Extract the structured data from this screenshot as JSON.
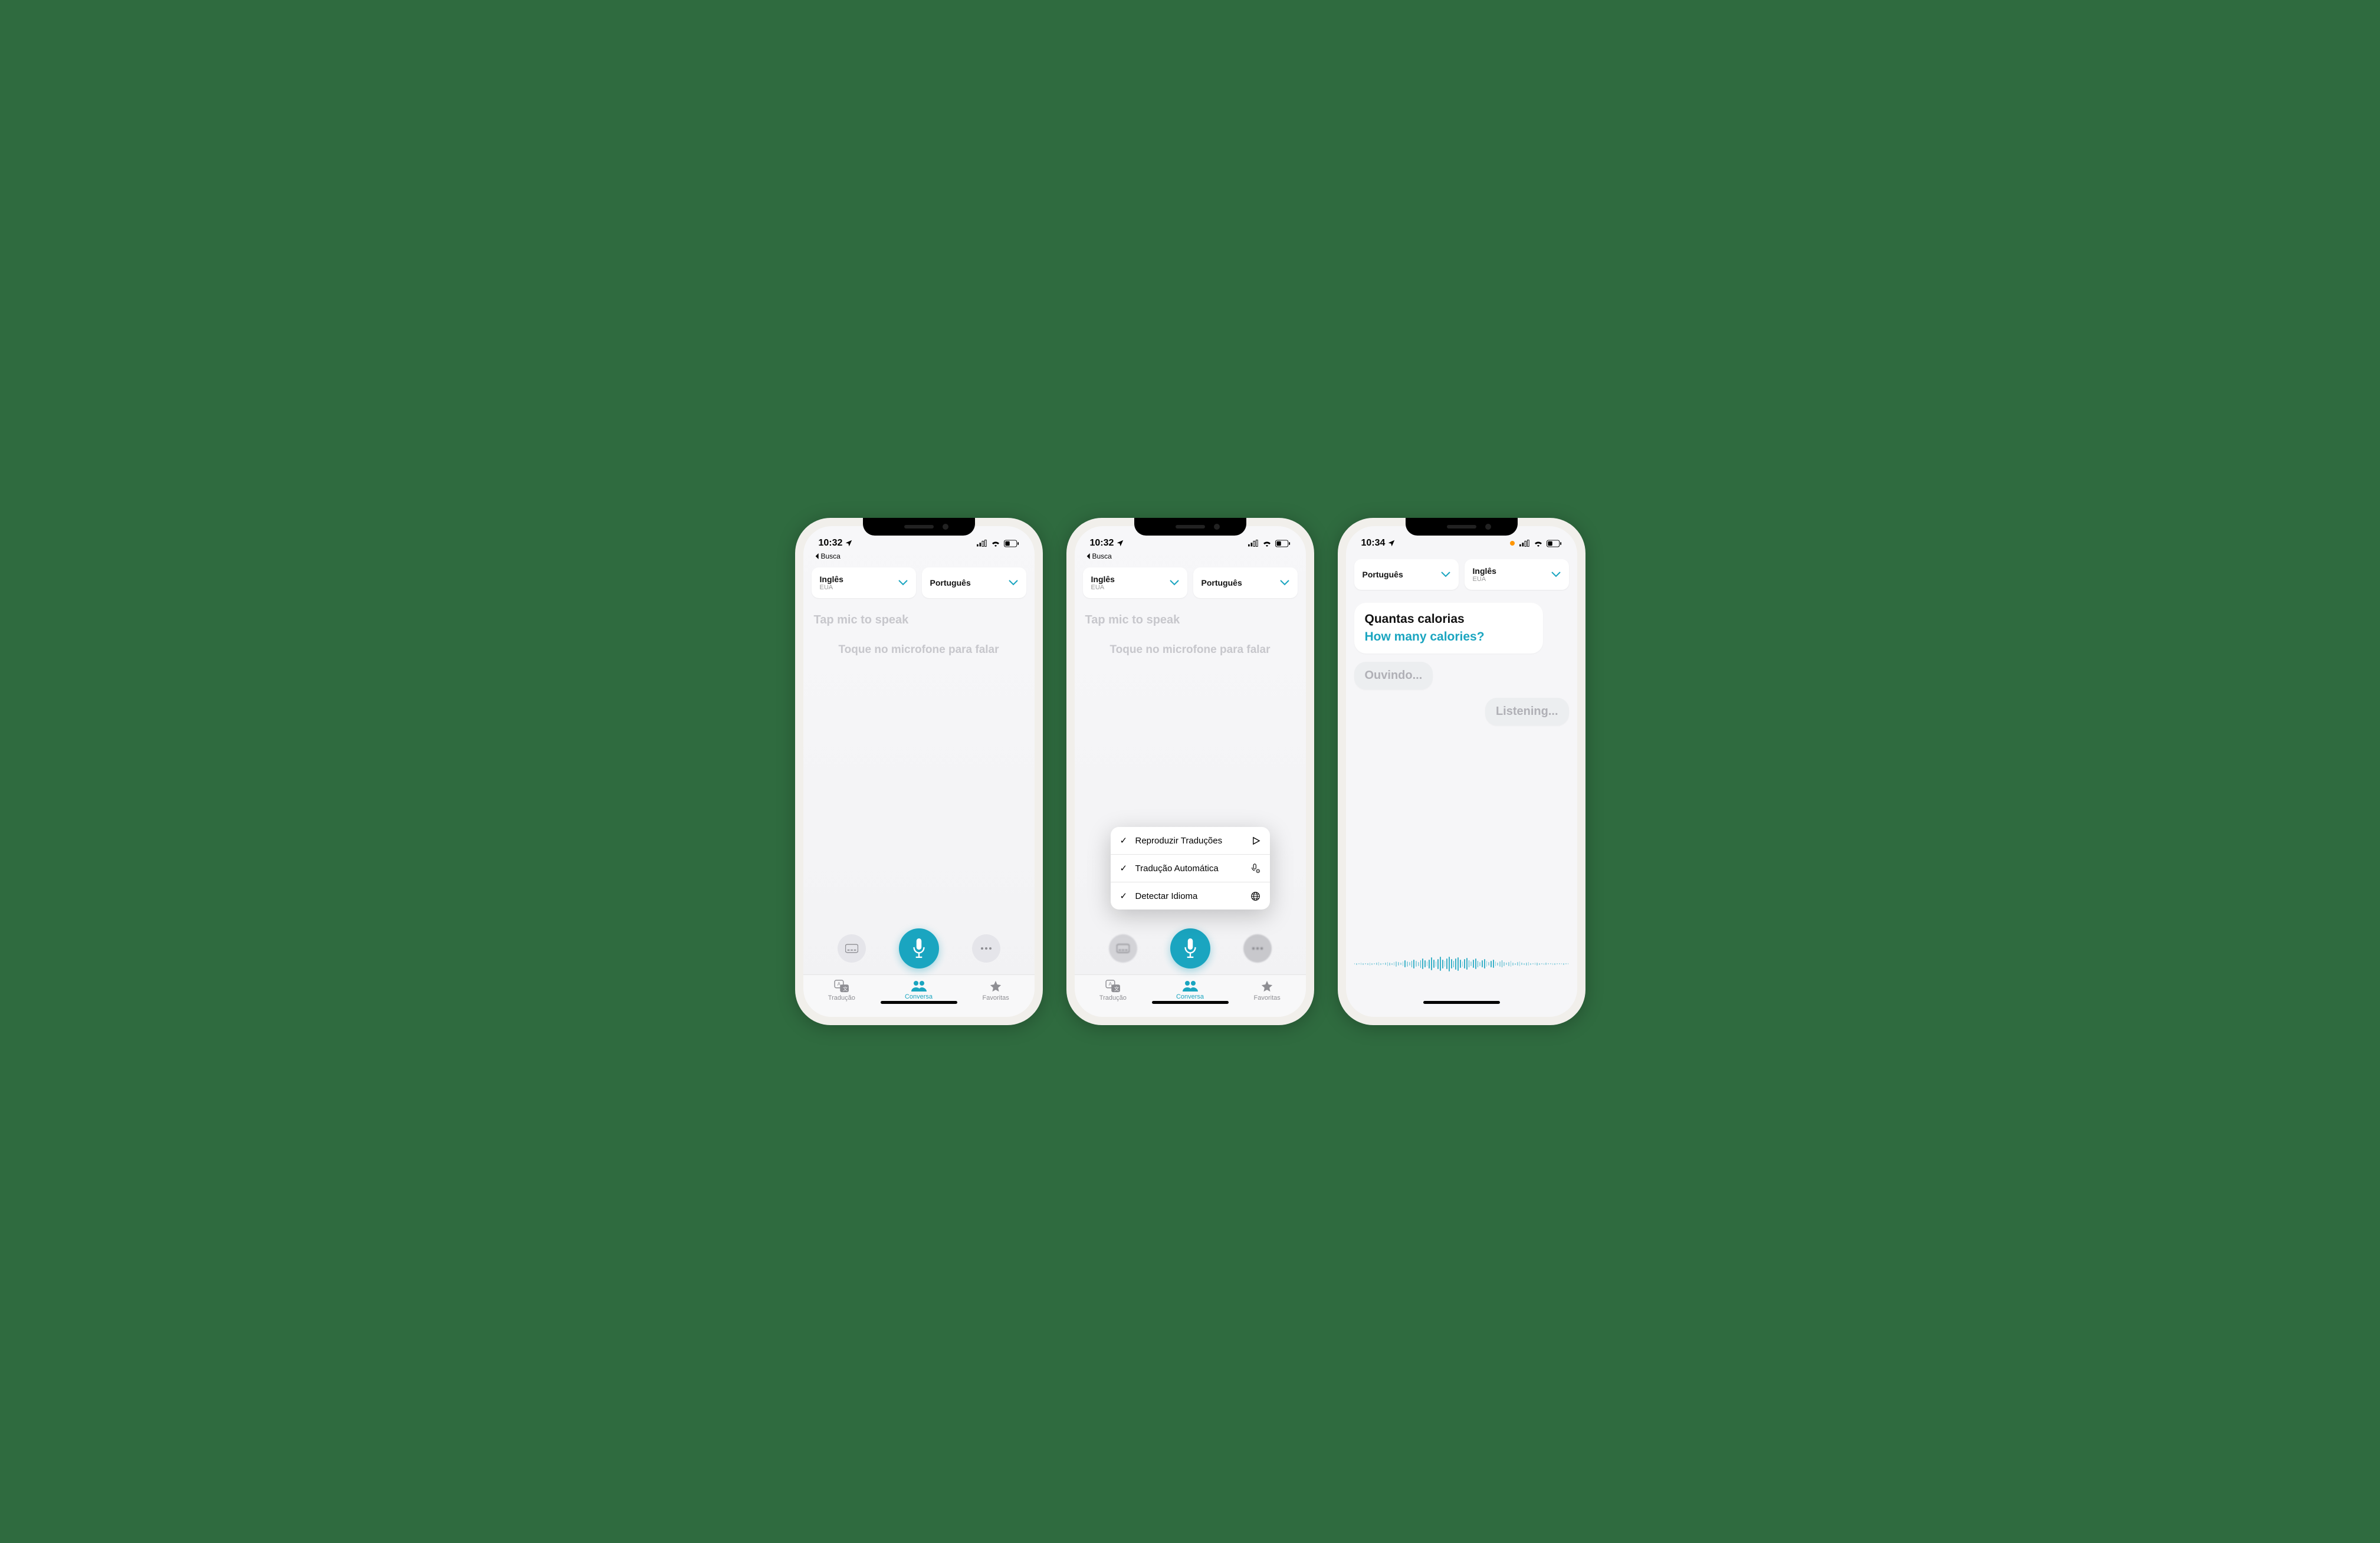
{
  "colors": {
    "accent": "#1aa5c0",
    "muted": "#8e8e93",
    "bg": "#f7f7f9"
  },
  "phone1": {
    "time": "10:32",
    "back": "Busca",
    "lang_a": {
      "name": "Inglês",
      "sub": "EUA"
    },
    "lang_b": {
      "name": "Português",
      "sub": ""
    },
    "prompt1": "Tap mic to speak",
    "prompt2": "Toque no microfone para falar",
    "tabs": {
      "translate": "Tradução",
      "conversation": "Conversa",
      "favorites": "Favoritas"
    }
  },
  "phone2": {
    "time": "10:32",
    "back": "Busca",
    "lang_a": {
      "name": "Inglês",
      "sub": "EUA"
    },
    "lang_b": {
      "name": "Português",
      "sub": ""
    },
    "prompt1": "Tap mic to speak",
    "prompt2": "Toque no microfone para falar",
    "menu": [
      {
        "checked": true,
        "label": "Reproduzir Traduções",
        "icon": "play"
      },
      {
        "checked": true,
        "label": "Tradução Automática",
        "icon": "mic-gear"
      },
      {
        "checked": true,
        "label": "Detectar Idioma",
        "icon": "globe"
      }
    ],
    "tabs": {
      "translate": "Tradução",
      "conversation": "Conversa",
      "favorites": "Favoritas"
    }
  },
  "phone3": {
    "time": "10:34",
    "lang_a": {
      "name": "Português",
      "sub": ""
    },
    "lang_b": {
      "name": "Inglês",
      "sub": "EUA"
    },
    "bubble": {
      "src": "Quantas calorias",
      "dst": "How many calories?"
    },
    "listening_a": "Ouvindo...",
    "listening_b": "Listening..."
  }
}
